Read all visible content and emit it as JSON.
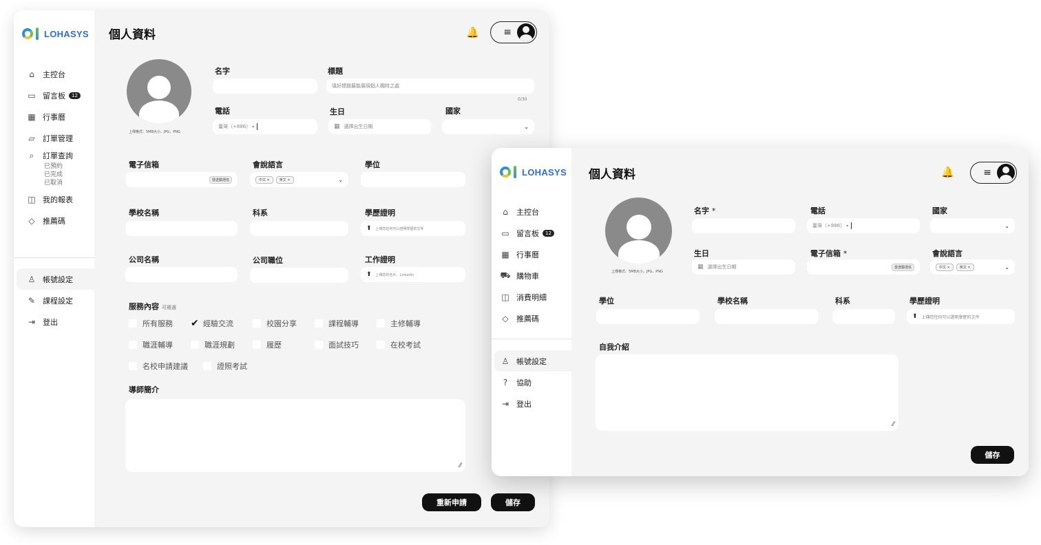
{
  "brand": "LOHASYS",
  "colors": {
    "accent": "#2f6fd0",
    "button": "#111111",
    "panel": "#f4f4f4"
  },
  "w1": {
    "title": "個人資料",
    "nav": [
      {
        "label": "主控台",
        "icon": "home-icon"
      },
      {
        "label": "留言板",
        "icon": "chat-icon",
        "badge": "12"
      },
      {
        "label": "行事曆",
        "icon": "calendar-icon"
      },
      {
        "label": "訂單管理",
        "icon": "folder-icon"
      },
      {
        "label": "訂單查詢",
        "icon": "search-icon"
      },
      {
        "label": "我的報表",
        "icon": "report-icon"
      },
      {
        "label": "推薦碼",
        "icon": "tag-icon"
      }
    ],
    "order_sub": [
      "已預約",
      "已完成",
      "已取消"
    ],
    "nav_bottom": [
      {
        "label": "帳號設定",
        "icon": "user-icon"
      },
      {
        "label": "課程設定",
        "icon": "edit-icon"
      },
      {
        "label": "登出",
        "icon": "logout-icon"
      }
    ],
    "avatar_hint": "上傳格式：5MB大小，JPG，PNG",
    "labels": {
      "name": "名字",
      "headline": "標題",
      "phone": "電話",
      "birthday": "生日",
      "country": "國家",
      "email": "電子信箱",
      "languages": "會說語言",
      "degree": "學位",
      "school": "學校名稱",
      "dept": "科系",
      "edu_proof": "學歷證明",
      "company": "公司名稱",
      "position": "公司職位",
      "work_proof": "工作證明",
      "services": "服務內容",
      "services_opt": "可複選",
      "bio": "導師簡介"
    },
    "placeholders": {
      "headline": "填好標題最能展現個人獨特之處",
      "phone_prefix": "臺灣（+886）",
      "birthday": "選擇出生日期",
      "edu_proof": "上傳您任何可以證明學歷的文件",
      "work_proof": "上傳您的名片、Linkedin"
    },
    "headline_counter": "0/30",
    "email_verify": "發送驗證信",
    "lang_chips": [
      "中文",
      "英文"
    ],
    "services": [
      {
        "label": "所有服務",
        "checked": false
      },
      {
        "label": "經驗交流",
        "checked": true
      },
      {
        "label": "校園分享",
        "checked": false
      },
      {
        "label": "課程輔導",
        "checked": false
      },
      {
        "label": "主修輔導",
        "checked": false
      },
      {
        "label": "職涯輔導",
        "checked": false
      },
      {
        "label": "職涯規劃",
        "checked": false
      },
      {
        "label": "履歷",
        "checked": false
      },
      {
        "label": "面試技巧",
        "checked": false
      },
      {
        "label": "在校考試",
        "checked": false
      },
      {
        "label": "名校申請建議",
        "checked": false
      },
      {
        "label": "證照考試",
        "checked": false
      }
    ],
    "reapply": "重新申請",
    "save": "儲存"
  },
  "w2": {
    "title": "個人資料",
    "nav": [
      {
        "label": "主控台",
        "icon": "home-icon"
      },
      {
        "label": "留言板",
        "icon": "chat-icon",
        "badge": "12"
      },
      {
        "label": "行事曆",
        "icon": "calendar-icon"
      },
      {
        "label": "購物車",
        "icon": "cart-icon"
      },
      {
        "label": "消費明細",
        "icon": "receipt-icon"
      },
      {
        "label": "推薦碼",
        "icon": "tag-icon"
      }
    ],
    "nav_bottom": [
      {
        "label": "帳號設定",
        "icon": "user-icon"
      },
      {
        "label": "協助",
        "icon": "help-icon"
      },
      {
        "label": "登出",
        "icon": "logout-icon"
      }
    ],
    "avatar_hint": "上傳格式：5MB大小，JPG，PNG",
    "labels": {
      "name": "名字",
      "name_req": "*",
      "phone": "電話",
      "country": "國家",
      "birthday": "生日",
      "email": "電子信箱",
      "email_req": "*",
      "languages": "會說語言",
      "degree": "學位",
      "school": "學校名稱",
      "dept": "科系",
      "edu_proof": "學歷證明",
      "bio": "自我介紹"
    },
    "placeholders": {
      "phone_prefix": "臺灣（+886）",
      "birthday": "選擇出生日期",
      "edu_proof": "上傳您任何可以證明學歷的文件"
    },
    "email_verify": "發送驗證信",
    "lang_chips": [
      "中文",
      "英文"
    ],
    "save": "儲存"
  }
}
